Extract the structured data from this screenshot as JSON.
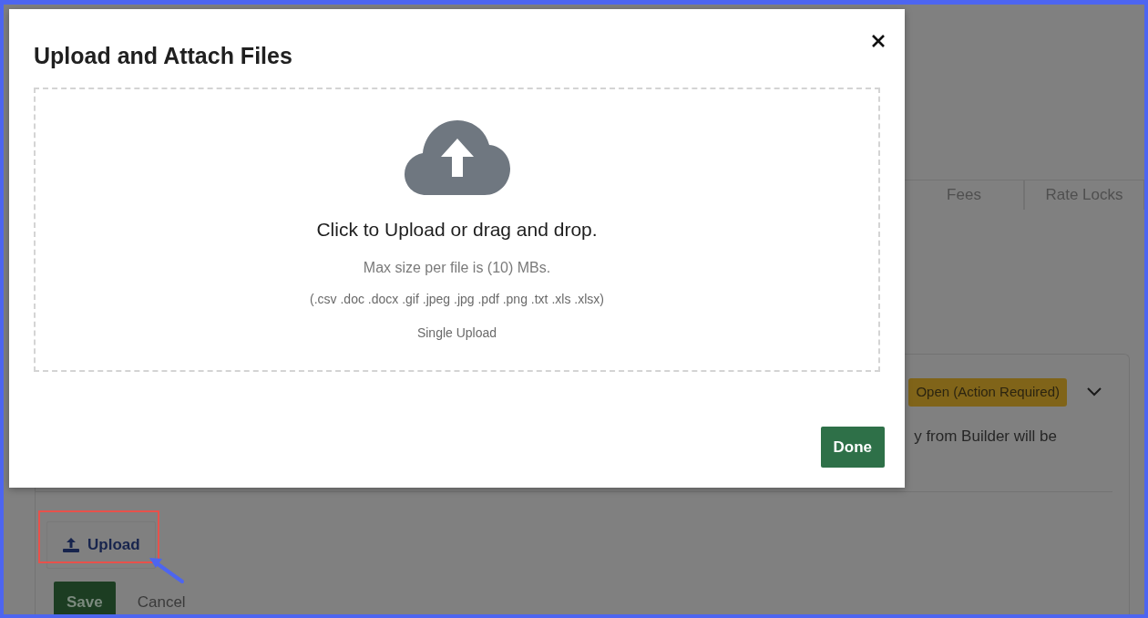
{
  "background": {
    "tabs": [
      {
        "label": "Fees"
      },
      {
        "label": "Rate Locks"
      }
    ],
    "status_badge": "Open (Action Required)",
    "text_fragment": "y from Builder will be",
    "upload_button": "Upload",
    "save_button": "Save",
    "cancel_link": "Cancel"
  },
  "modal": {
    "title": "Upload and Attach Files",
    "dropzone": {
      "prompt": "Click to Upload or drag and drop.",
      "max_size": "Max size per file is (10) MBs.",
      "file_types": "(.csv .doc .docx .gif .jpeg .jpg .pdf .png .txt .xls .xlsx)",
      "mode": "Single Upload"
    },
    "done_button": "Done"
  }
}
